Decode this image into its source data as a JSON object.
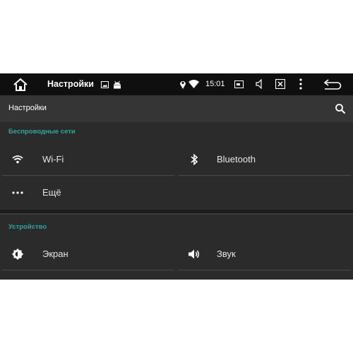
{
  "status_bar": {
    "title": "Настройки",
    "time": "15:01",
    "icons": [
      "home-icon",
      "image-icon",
      "android-icon",
      "location-icon",
      "wifi-icon",
      "screen-cast-icon",
      "volume-icon",
      "close-box-icon",
      "more-vert-icon",
      "back-icon"
    ]
  },
  "action_bar": {
    "title": "Настройки",
    "search_icon": "search-icon"
  },
  "sections": [
    {
      "header": "Беспроводные сети",
      "items": [
        {
          "label": "Wi-Fi",
          "icon": "wifi-icon"
        },
        {
          "label": "Bluetooth",
          "icon": "bluetooth-icon"
        },
        {
          "label": "Ещё",
          "icon": "more-horiz-icon"
        }
      ]
    },
    {
      "header": "Устройство",
      "items": [
        {
          "label": "Экран",
          "icon": "brightness-icon"
        },
        {
          "label": "Звук",
          "icon": "volume-icon"
        }
      ]
    }
  ],
  "colors": {
    "status_bar_bg": "#0f0f0f",
    "action_bar_bg": "#353535",
    "content_bg": "#2b2b2b",
    "section_header": "#29a7a0",
    "text": "#e6e6e6"
  }
}
